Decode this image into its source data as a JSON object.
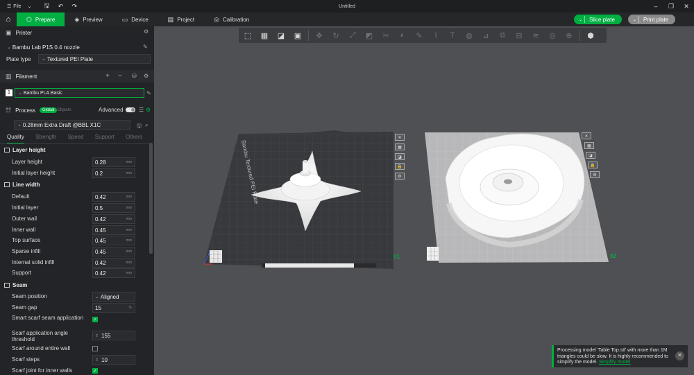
{
  "titlebar": {
    "file_label": "File",
    "title": "Untitled"
  },
  "tabs": [
    {
      "label": "Prepare",
      "icon": "cube-icon",
      "active": true
    },
    {
      "label": "Preview",
      "icon": "layers-icon",
      "active": false
    },
    {
      "label": "Device",
      "icon": "monitor-icon",
      "active": false
    },
    {
      "label": "Project",
      "icon": "project-icon",
      "active": false
    },
    {
      "label": "Calibration",
      "icon": "target-icon",
      "active": false
    }
  ],
  "actions": {
    "slice_label": "Slice plate",
    "print_label": "Print plate"
  },
  "printer": {
    "header": "Printer",
    "name": "Bambu Lab P1S 0.4 nozzle",
    "plate_type_label": "Plate type",
    "plate_type": "Textured PEI Plate"
  },
  "filament": {
    "header": "Filament",
    "slot": "1",
    "name": "Bambu PLA Basic"
  },
  "process": {
    "header": "Process",
    "global_label": "Global",
    "objects_label": "Objects",
    "advanced_label": "Advanced",
    "preset": "0.28mm Extra Draft @BBL X1C",
    "subtabs": [
      "Quality",
      "Strength",
      "Speed",
      "Support",
      "Others"
    ]
  },
  "groups": {
    "layer_height": "Layer height",
    "line_width": "Line width",
    "seam": "Seam"
  },
  "params": {
    "layer_height": {
      "label": "Layer height",
      "value": "0.28",
      "unit": "mm"
    },
    "initial_layer_height": {
      "label": "Initial layer height",
      "value": "0.2",
      "unit": "mm"
    },
    "lw_default": {
      "label": "Default",
      "value": "0.42",
      "unit": "mm"
    },
    "lw_initial_layer": {
      "label": "Initial layer",
      "value": "0.5",
      "unit": "mm"
    },
    "lw_outer_wall": {
      "label": "Outer wall",
      "value": "0.42",
      "unit": "mm"
    },
    "lw_inner_wall": {
      "label": "Inner wall",
      "value": "0.45",
      "unit": "mm"
    },
    "lw_top_surface": {
      "label": "Top surface",
      "value": "0.45",
      "unit": "mm"
    },
    "lw_sparse_infill": {
      "label": "Sparse infill",
      "value": "0.45",
      "unit": "mm"
    },
    "lw_internal_solid_infill": {
      "label": "Internal solid infill",
      "value": "0.42",
      "unit": "mm"
    },
    "lw_support": {
      "label": "Support",
      "value": "0.42",
      "unit": "mm"
    },
    "seam_position": {
      "label": "Seam position",
      "value": "Aligned"
    },
    "seam_gap": {
      "label": "Seam gap",
      "value": "15",
      "unit": "%"
    },
    "smart_scarf": {
      "label": "Smart scarf seam application",
      "checked": true
    },
    "scarf_threshold": {
      "label": "Scarf application angle threshold",
      "value": "155"
    },
    "scarf_entire_wall": {
      "label": "Scarf around entire wall",
      "checked": false
    },
    "scarf_steps": {
      "label": "Scarf steps",
      "value": "10"
    },
    "scarf_inner_walls": {
      "label": "Scarf joint for inner walls",
      "checked": true
    }
  },
  "plates": {
    "plate1_label": "Bambu Textured PEI Plate",
    "plate1_number": "01",
    "plate2_number": "02"
  },
  "notice": {
    "text": "Processing model 'Table Top.stl' with more than 1M triangles could be slow. It is highly recommended to simplify the model.",
    "link": "Simplify model"
  },
  "colors": {
    "accent": "#00ae42",
    "panel": "#232427",
    "viewport": "#4f5054"
  }
}
